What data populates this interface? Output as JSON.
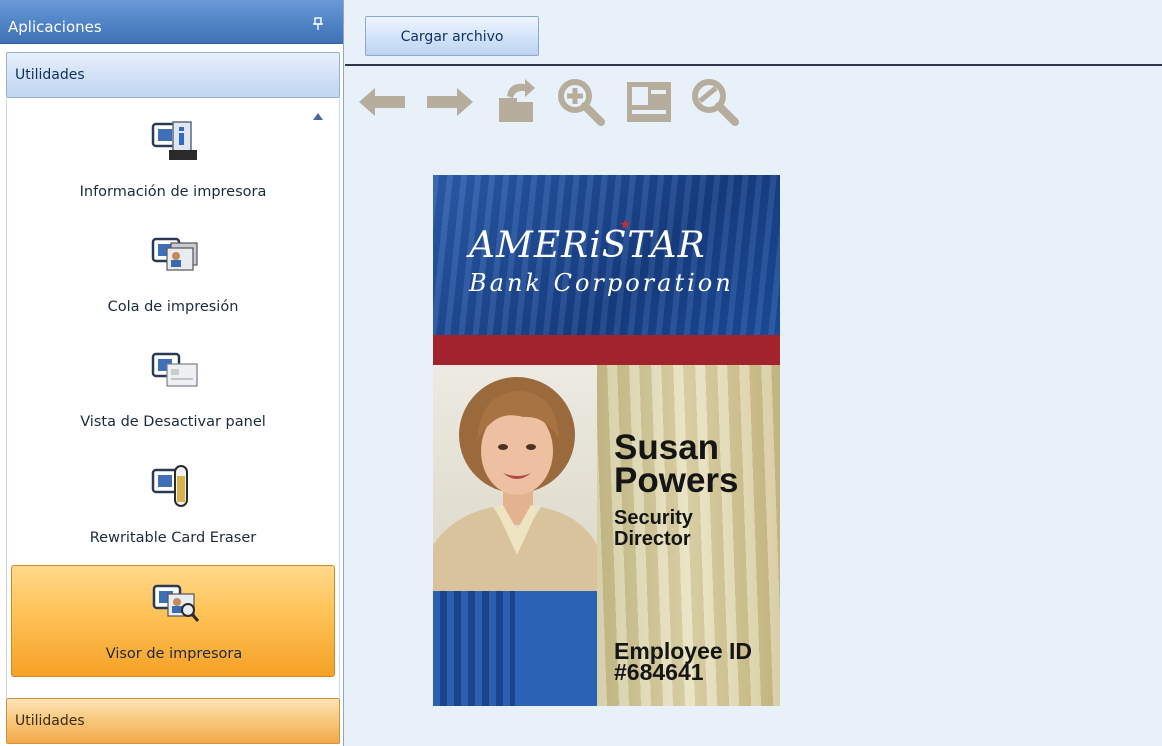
{
  "sidebar": {
    "header_title": "Aplicaciones",
    "pin_icon": "pin-icon",
    "group_top": "Utilidades",
    "group_bottom": "Utilidades",
    "items": [
      {
        "label": "Información de impresora",
        "icon": "printer-info-icon",
        "active": false
      },
      {
        "label": "Cola de impresión",
        "icon": "print-queue-icon",
        "active": false
      },
      {
        "label": "Vista de Desactivar panel",
        "icon": "disable-panel-view-icon",
        "active": false
      },
      {
        "label": "Rewritable Card Eraser",
        "icon": "card-eraser-icon",
        "active": false
      },
      {
        "label": "Visor de impresora",
        "icon": "printer-viewer-icon",
        "active": true
      }
    ]
  },
  "toolbar": {
    "load_file_label": "Cargar archivo",
    "tools": [
      "arrow-left-icon",
      "arrow-right-icon",
      "rotate-icon",
      "zoom-in-icon",
      "id-card-icon",
      "zoom-out-icon"
    ]
  },
  "card": {
    "brand_main": "AMERiSTAR",
    "brand_sub": "Bank Corporation",
    "name_line1": "Susan",
    "name_line2": "Powers",
    "title_line1": "Security",
    "title_line2": "Director",
    "empid_line1": "Employee ID",
    "empid_line2": "#684641"
  },
  "colors": {
    "header_blue": "#4f83c5",
    "active_orange": "#ffc45a",
    "card_red": "#a3232c",
    "card_blue": "#1f4f9c"
  }
}
